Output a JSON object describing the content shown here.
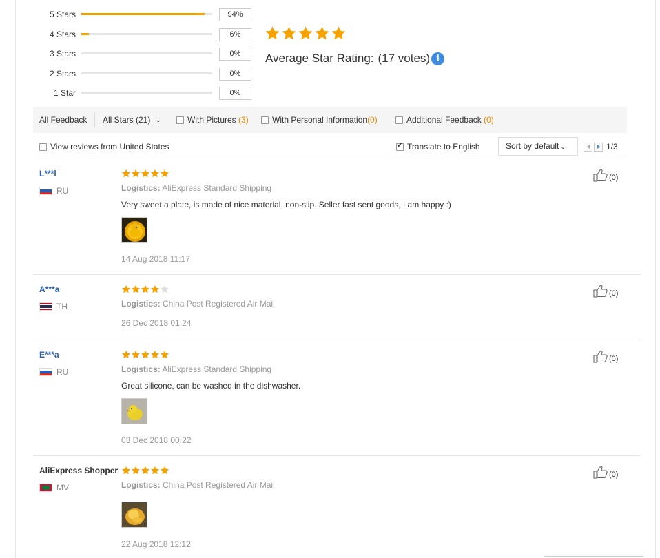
{
  "summary": {
    "rows": [
      {
        "label": "5 Stars",
        "percent": "94%",
        "fill": 0.94
      },
      {
        "label": "4 Stars",
        "percent": "6%",
        "fill": 0.06
      },
      {
        "label": "3 Stars",
        "percent": "0%",
        "fill": 0
      },
      {
        "label": "2 Stars",
        "percent": "0%",
        "fill": 0
      },
      {
        "label": "1 Star",
        "percent": "0%",
        "fill": 0
      }
    ],
    "average_stars": 5,
    "avg_label": "Average Star Rating:",
    "votes": "(17 votes)",
    "info_icon": "i"
  },
  "filters": {
    "all_feedback": "All Feedback",
    "all_stars": "All Stars (21)",
    "with_pictures": "With Pictures",
    "with_pictures_count": "(3)",
    "with_personal": "With Personal Information",
    "with_personal_count": "(0)",
    "additional": "Additional Feedback",
    "additional_count": "(0)"
  },
  "options": {
    "view_us": "View reviews from United States",
    "translate": "Translate to English",
    "translate_checked": true,
    "sort": "Sort by default",
    "page": "1/3"
  },
  "colors": {
    "star": "#f5a200",
    "star_empty": "#dddddd",
    "link": "#2660b3",
    "accent_count": "#e88c00"
  },
  "reviews": [
    {
      "name": "L***l",
      "country": "RU",
      "stars": 5,
      "logistics_label": "Logistics:",
      "logistics": "AliExpress Standard Shipping",
      "text": "Very sweet a plate, is made of nice material, non-slip. Seller fast sent goods, I am happy :)",
      "has_photo": true,
      "date": "14 Aug 2018 11:17",
      "likes": "(0)"
    },
    {
      "name": "A***a",
      "country": "TH",
      "stars": 4,
      "logistics_label": "Logistics:",
      "logistics": "China Post Registered Air Mail",
      "text": "",
      "has_photo": false,
      "date": "26 Dec 2018 01:24",
      "likes": "(0)"
    },
    {
      "name": "E***a",
      "country": "RU",
      "stars": 5,
      "logistics_label": "Logistics:",
      "logistics": "AliExpress Standard Shipping",
      "text": "Great silicone, can be washed in the dishwasher.",
      "has_photo": true,
      "date": "03 Dec 2018 00:22",
      "likes": "(0)"
    },
    {
      "name": "AliExpress Shopper",
      "country": "MV",
      "stars": 5,
      "logistics_label": "Logistics:",
      "logistics": "China Post Registered Air Mail",
      "text": "",
      "has_photo": true,
      "date": "22 Aug 2018 12:12",
      "likes": "(0)"
    }
  ]
}
